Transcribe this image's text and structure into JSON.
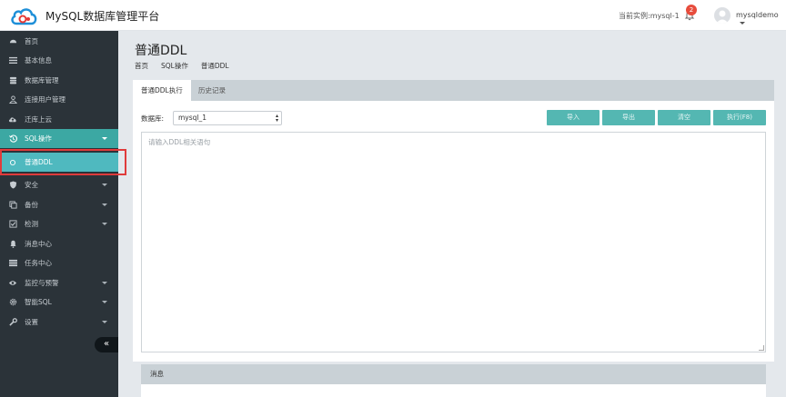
{
  "header": {
    "app_title": "MySQL数据库管理平台",
    "instance_label": "当前实例:mysql-1",
    "notification_count": "2",
    "username": "mysqldemo"
  },
  "sidebar": {
    "items": [
      {
        "label": "首页",
        "icon": "dashboard-icon"
      },
      {
        "label": "基本信息",
        "icon": "list-icon"
      },
      {
        "label": "数据库管理",
        "icon": "database-icon"
      },
      {
        "label": "连接用户管理",
        "icon": "user-icon"
      },
      {
        "label": "迁库上云",
        "icon": "cloud-upload-icon"
      },
      {
        "label": "SQL操作",
        "icon": "history-icon",
        "active": true
      },
      {
        "label": "普通DDL",
        "icon": "circle-icon",
        "sub": true
      },
      {
        "label": "安全",
        "icon": "shield-icon"
      },
      {
        "label": "备份",
        "icon": "copy-icon"
      },
      {
        "label": "检测",
        "icon": "check-square-icon"
      },
      {
        "label": "消息中心",
        "icon": "bell-icon"
      },
      {
        "label": "任务中心",
        "icon": "tasks-icon"
      },
      {
        "label": "监控与预警",
        "icon": "eye-icon"
      },
      {
        "label": "智能SQL",
        "icon": "gear-icon"
      },
      {
        "label": "设置",
        "icon": "wrench-icon"
      }
    ],
    "collapse_label": "«"
  },
  "main": {
    "page_title": "普通DDL",
    "breadcrumb": [
      "首页",
      "SQL操作",
      "普通DDL"
    ],
    "tabs": [
      {
        "label": "普通DDL执行",
        "active": true
      },
      {
        "label": "历史记录"
      }
    ],
    "db_label": "数据库:",
    "db_selected": "mysql_1",
    "buttons": {
      "import": "导入",
      "export": "导出",
      "clear": "清空",
      "execute": "执行(F8)"
    },
    "editor_placeholder": "请输入DDL相关语句",
    "message_title": "消息"
  },
  "colors": {
    "accent": "#54b7b2",
    "sidebar_bg": "#2b3339",
    "active_item": "#3ca8a3",
    "badge": "#e74c3c"
  }
}
